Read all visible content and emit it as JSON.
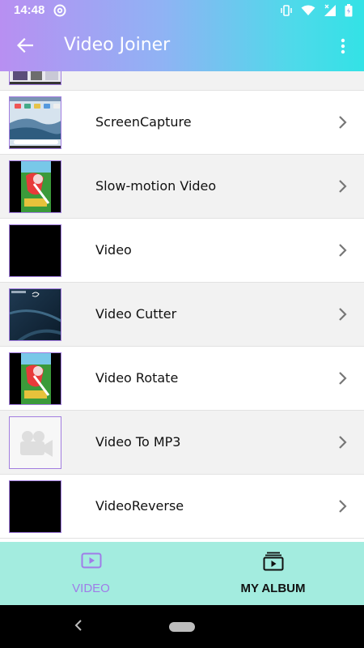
{
  "status_bar": {
    "time": "14:48",
    "left_icon": "at-sign-notification-icon",
    "right_icons": [
      "vibrate-icon",
      "wifi-icon",
      "signal-icon",
      "battery-icon"
    ]
  },
  "app_bar": {
    "title": "Video Joiner",
    "back_icon": "arrow-back-icon",
    "menu_icon": "more-vertical-icon"
  },
  "list": {
    "items": [
      {
        "label": "",
        "thumbnail": "partial-screenshot"
      },
      {
        "label": "ScreenCapture",
        "thumbnail": "phone-screenshot"
      },
      {
        "label": "Slow-motion Video",
        "thumbnail": "cartoon-frame"
      },
      {
        "label": "Video",
        "thumbnail": "black-frame"
      },
      {
        "label": "Video Cutter",
        "thumbnail": "dark-blue-frame"
      },
      {
        "label": "Video Rotate",
        "thumbnail": "cartoon-frame"
      },
      {
        "label": "Video To MP3",
        "thumbnail": "camera-placeholder"
      },
      {
        "label": "VideoReverse",
        "thumbnail": "black-frame"
      }
    ]
  },
  "bottom_nav": {
    "tabs": [
      {
        "label": "VIDEO",
        "icon": "play-box-icon",
        "active": true
      },
      {
        "label": "MY ALBUM",
        "icon": "album-icon",
        "active": false
      }
    ]
  },
  "colors": {
    "gradient_start": "#b88ff2",
    "gradient_end": "#33e2e6",
    "bottom_nav_bg": "#a3ecdf",
    "accent_purple": "#a07ce8"
  }
}
